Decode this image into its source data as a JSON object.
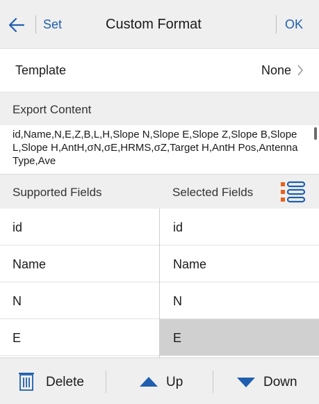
{
  "header": {
    "back_icon": "arrow-left-icon",
    "set_label": "Set",
    "title": "Custom Format",
    "ok_label": "OK",
    "accent_color": "#1f5fae"
  },
  "template": {
    "label": "Template",
    "value": "None"
  },
  "export": {
    "header": "Export Content",
    "content": "id,Name,N,E,Z,B,L,H,Slope N,Slope E,Slope Z,Slope B,Slope L,Slope H,AntH,σN,σE,HRMS,σZ,Target H,AntH Pos,Antenna Type,Ave"
  },
  "fields": {
    "supported_label": "Supported Fields",
    "selected_label": "Selected Fields",
    "supported": [
      "id",
      "Name",
      "N",
      "E"
    ],
    "selected": [
      "id",
      "Name",
      "N",
      "E"
    ],
    "selected_index": 3,
    "selected_highlight_color": "#d0d0d0"
  },
  "footer": {
    "delete_label": "Delete",
    "up_label": "Up",
    "down_label": "Down",
    "delete_icon": "trash-icon",
    "up_icon": "triangle-up-icon",
    "down_icon": "triangle-down-icon"
  }
}
